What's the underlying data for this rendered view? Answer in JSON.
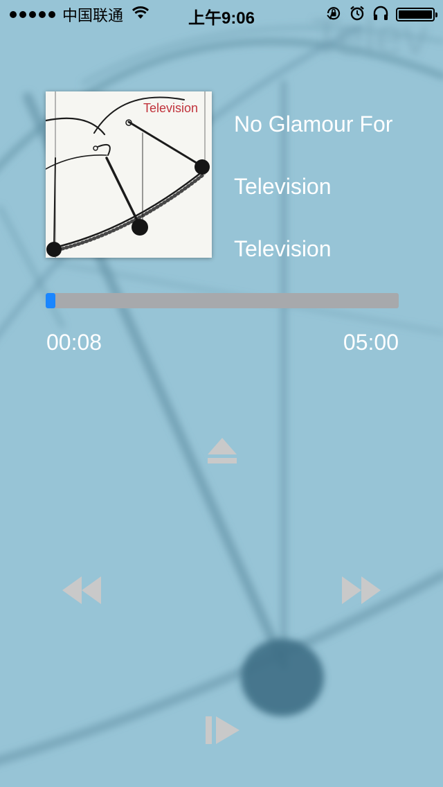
{
  "status_bar": {
    "carrier": "中国联通",
    "time": "上午9:06",
    "icons": [
      "signal-dots",
      "wifi-icon",
      "rotation-lock-icon",
      "alarm-icon",
      "headphones-icon",
      "battery-icon"
    ],
    "battery_level": 1.0
  },
  "album_art": {
    "title": "Television",
    "title_color": "#c0323b"
  },
  "track": {
    "song": "No Glamour For Willi",
    "artist": "Television",
    "album": "Television"
  },
  "progress": {
    "elapsed": "00:08",
    "total": "05:00",
    "fraction": 0.027,
    "fill_color": "#1a86ff"
  },
  "controls": {
    "eject": "eject-icon",
    "rewind": "rewind-icon",
    "fast_forward": "fast-forward-icon",
    "play": "play-pause-icon"
  },
  "colors": {
    "background": "#97c4d6",
    "control_gray": "#c9c9c9"
  }
}
